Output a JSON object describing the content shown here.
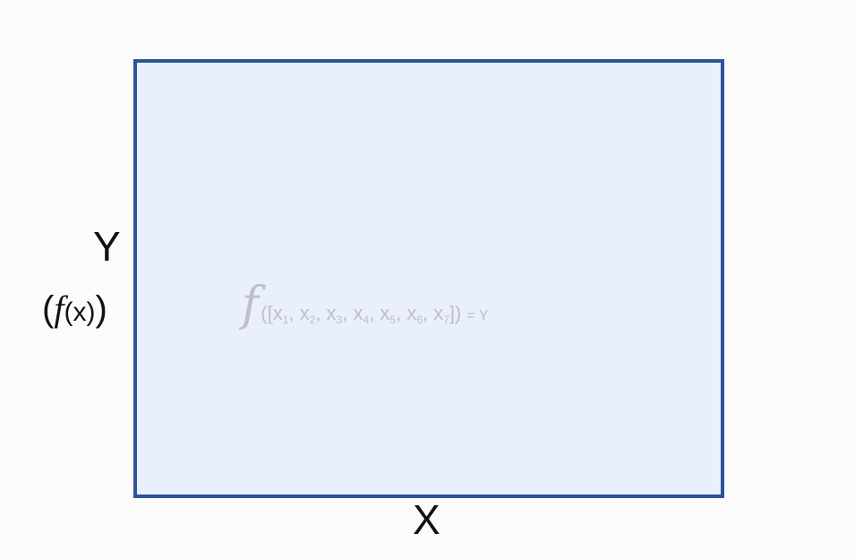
{
  "diagram": {
    "y_axis_label": "Y",
    "y_axis_sublabel": {
      "open": "(",
      "function": "f",
      "argument": "(x)",
      "close": ")"
    },
    "x_axis_label": "X",
    "formula": {
      "function_symbol": "f",
      "open": "([",
      "terms": [
        {
          "base": "x",
          "sub": "1"
        },
        {
          "base": "x",
          "sub": "2"
        },
        {
          "base": "x",
          "sub": "3"
        },
        {
          "base": "x",
          "sub": "4"
        },
        {
          "base": "x",
          "sub": "5"
        },
        {
          "base": "x",
          "sub": "6"
        },
        {
          "base": "x",
          "sub": "7"
        }
      ],
      "close": "])",
      "rhs": "= Y"
    },
    "colors": {
      "box_fill": "#e9effc",
      "box_border": "#2c5496",
      "formula_text": "#bfbfc6",
      "label_text": "#111111"
    }
  }
}
